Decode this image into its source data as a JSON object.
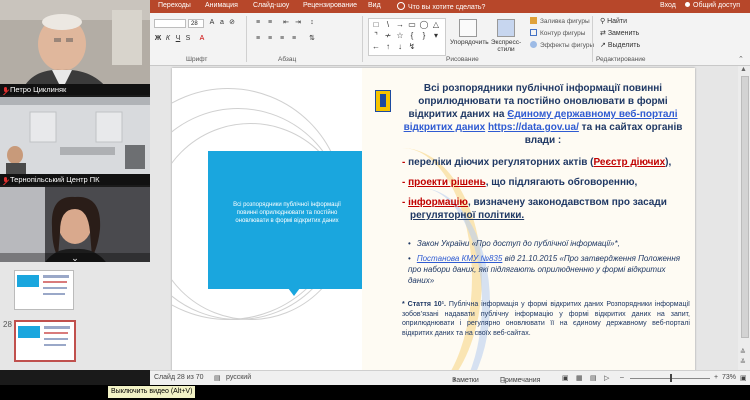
{
  "ribbon": {
    "tabs": [
      "Переходы",
      "Анимация",
      "Слайд-шоу",
      "Рецензирование",
      "Вид"
    ],
    "tell_me": "Что вы хотите сделать?",
    "user": "Вход",
    "share": "Общий доступ",
    "font_size": "28",
    "groups": [
      "Шрифт",
      "Абзац",
      "Рисование",
      "Редактирование"
    ],
    "arrange": "Упорядочить",
    "quick_styles": "Экспресс-стили",
    "shape_fill": "Заливка фигуры",
    "shape_outline": "Контур фигуры",
    "shape_effects": "Эффекты фигуры",
    "find": "Найти",
    "replace": "Заменить",
    "select": "Выделить",
    "colors": {
      "accent": "#b7472a"
    }
  },
  "participants": [
    {
      "name": "Петро Циклиняк",
      "muted": true
    },
    {
      "name": "Тернопільський Центр ПК",
      "muted": true
    }
  ],
  "slide": {
    "left_box_text": "Всі розпорядники публічної інформації повинні оприлюднювати та постійно оновлювати в формі відкритих даних",
    "heading_a": "Всі розпорядники публічної інформації повинні оприлюднювати та постійно оновлювати в формі відкритих даних на ",
    "heading_link": "Єдиному державному веб-порталі відкритих даних",
    "heading_url": "https://data.gov.ua/",
    "heading_b": " та на сайтах органів влади :",
    "b1_a": "переліки діючих регуляторних актів (",
    "b1_red": "Реєстр діючих",
    "b1_b": "),",
    "b2_red": "проекти рішень",
    "b2_b": ", що підлягають обговоренню,",
    "b3_red": "інформацію",
    "b3_b": ", визначену законодавством про засади",
    "b3_c": "регуляторної політики.",
    "law1": "Закон України «Про доступ до публічної інформації»*,",
    "law2_link": "Постанова КМУ №835",
    "law2_rest": " від 21.10.2015 «Про затвердження Положення про набори даних, які підлягають оприлюдненню у формі відкритих даних»",
    "article_title": "* Стаття 10¹.",
    "article_text": " Публічна інформація у формі відкритих даних Розпорядники інформації зобов’язані надавати публічну інформацію у формі відкритих даних на запит, оприлюднювати і регулярно оновлювати її на єдиному державному веб-порталі відкритих даних та на своїх веб-сайтах."
  },
  "thumbnails": {
    "current": "28"
  },
  "status": {
    "slide_info": "Слайд 28 из 70",
    "language": "русский",
    "notes": "Заметки",
    "comments": "Примечания",
    "zoom": "73%"
  },
  "caption": "Выключить видео (Alt+V)"
}
